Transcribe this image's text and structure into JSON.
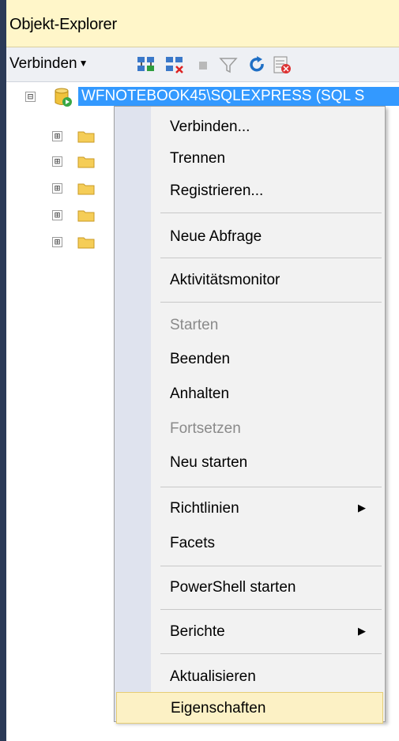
{
  "window": {
    "title": "Objekt-Explorer"
  },
  "toolbar": {
    "connect_label": "Verbinden",
    "icons": [
      "connect-object-explorer-icon",
      "disconnect-icon",
      "stop-icon",
      "filter-icon",
      "refresh-icon",
      "activity-monitor-icon"
    ]
  },
  "tree": {
    "server_label": "WFNOTEBOOK45\\SQLEXPRESS (SQL S",
    "server_expander": "⊟",
    "folder_expander": "⊞"
  },
  "context_menu": {
    "items": [
      {
        "label": "Verbinden..."
      },
      {
        "label": "Trennen"
      },
      {
        "label": "Registrieren..."
      },
      {
        "label": "Neue Abfrage"
      },
      {
        "label": "Aktivitätsmonitor"
      },
      {
        "label": "Starten",
        "disabled": true
      },
      {
        "label": "Beenden"
      },
      {
        "label": "Anhalten"
      },
      {
        "label": "Fortsetzen",
        "disabled": true
      },
      {
        "label": "Neu starten"
      },
      {
        "label": "Richtlinien",
        "submenu": true
      },
      {
        "label": "Facets"
      },
      {
        "label": "PowerShell starten"
      },
      {
        "label": "Berichte",
        "submenu": true
      },
      {
        "label": "Aktualisieren"
      },
      {
        "label": "Eigenschaften",
        "highlighted": true
      }
    ],
    "submenu_arrow": "▶"
  },
  "colors": {
    "title_bg": "#fff6c9",
    "selection": "#3399ff",
    "menu_bg": "#f2f2f2",
    "menu_gutter": "#dfe3ee",
    "hover_bg": "#fcf1c5",
    "disabled_text": "#8a8a8a"
  }
}
